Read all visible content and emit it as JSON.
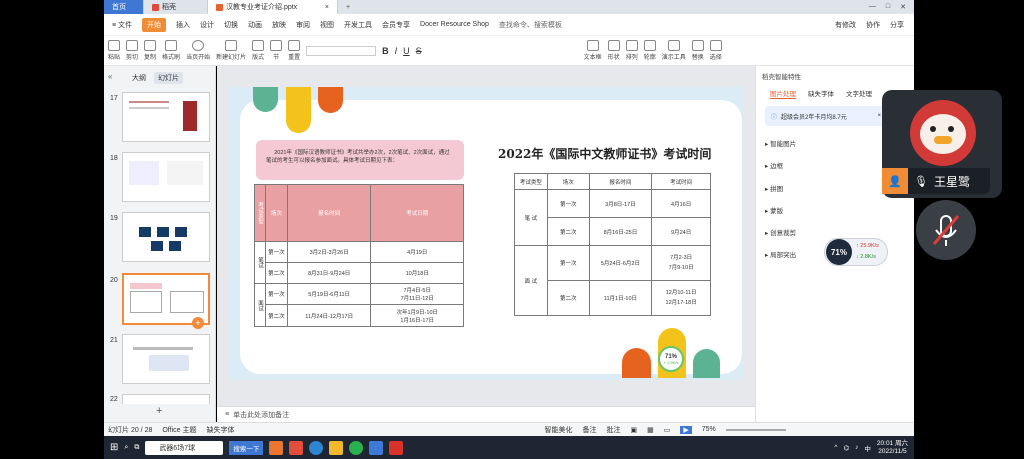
{
  "tabs": [
    {
      "label": "首页"
    },
    {
      "label": "稻壳"
    },
    {
      "label": "汉教专业考证介绍.pptx"
    }
  ],
  "menu": [
    "≡ 文件",
    "开始",
    "插入",
    "设计",
    "切换",
    "动画",
    "放映",
    "审阅",
    "视图",
    "开发工具",
    "会员专享",
    "Docer Resource Shop",
    "查找命令、搜索模板"
  ],
  "menu_right": [
    "有修改",
    "协作",
    "分享"
  ],
  "ribbon": [
    "粘贴",
    "剪切",
    "复制",
    "格式刷",
    "当页开始",
    "新建幻灯片",
    "版式",
    "节",
    "重置",
    "B",
    "I",
    "U",
    "S",
    "文本框",
    "形状",
    "排列",
    "轮廓",
    "演示工具",
    "替换",
    "选择"
  ],
  "thumbs_tabs": {
    "outline": "大纲",
    "slides": "幻灯片"
  },
  "thumb_numbers": [
    "17",
    "18",
    "19",
    "20",
    "21",
    "22"
  ],
  "slide": {
    "intro": "2021年《国际汉语教师证书》考试共举办2次，2次笔试、2次面试，通过笔试的考生可以报名参加面试。具体考试日期见下表：",
    "title": "2022年《国际中文教师证书》考试时间",
    "left_table": {
      "headers": [
        "考试类型",
        "场次",
        "报名时间",
        "考试日期"
      ],
      "groups": [
        {
          "type": "笔试",
          "rows": [
            [
              "第一次",
              "3月2日-3月26日",
              "4月19日"
            ],
            [
              "第二次",
              "8月31日-9月24日",
              "10月18日"
            ]
          ]
        },
        {
          "type": "面试",
          "rows": [
            [
              "第一次",
              "5月19日-6月11日",
              "7月4日-5日\n7月11日-12日"
            ],
            [
              "第二次",
              "11月24日-12月17日",
              "次年1月9日-10日\n1月16日-17日"
            ]
          ]
        }
      ]
    },
    "right_table": {
      "headers": [
        "考试类型",
        "场次",
        "报名时间",
        "考试时间"
      ],
      "groups": [
        {
          "type": "笔 试",
          "rows": [
            [
              "第一次",
              "3月8日-17日",
              "4月16日"
            ],
            [
              "第二次",
              "8月16日-25日",
              "9月24日"
            ]
          ]
        },
        {
          "type": "面 试",
          "rows": [
            [
              "第一次",
              "5月24日-6月2日",
              "7月2-3日\n7月9-10日"
            ],
            [
              "第二次",
              "11月1日-10日",
              "12月10-11日\n12月17-18日"
            ]
          ]
        }
      ]
    },
    "badge": "71%",
    "badge_sub": "+ 1.9K/s"
  },
  "right_pane": {
    "title": "稻壳智能特性",
    "tabs": [
      "图片处理",
      "缺失字体",
      "文字处理"
    ],
    "promo": "超级会员2年卡月均8.7元",
    "items": [
      "智能图片",
      "边框",
      "拼图",
      "蒙版",
      "创意裁剪",
      "局部突出"
    ],
    "meter": "71%",
    "meter_up": "25.9K/s",
    "meter_down": "2.8K/s"
  },
  "notes": "单击此处添加备注",
  "status": {
    "slide": "幻灯片 20 / 28",
    "theme": "Office 主题",
    "font": "缺失字体",
    "beautify": "智能美化",
    "notes": "备注",
    "comments": "批注",
    "zoom": "75%"
  },
  "taskbar": {
    "search": "武器6场7球",
    "app": "搜索一下",
    "clock_time": "20:01 周六",
    "clock_date": "2022/11/5",
    "lang": "中"
  },
  "video": {
    "name": "王星鹭"
  },
  "colors": {
    "accent": "#f08c35",
    "pink": "#e8a0a3",
    "tabblue": "#3f78d4"
  }
}
